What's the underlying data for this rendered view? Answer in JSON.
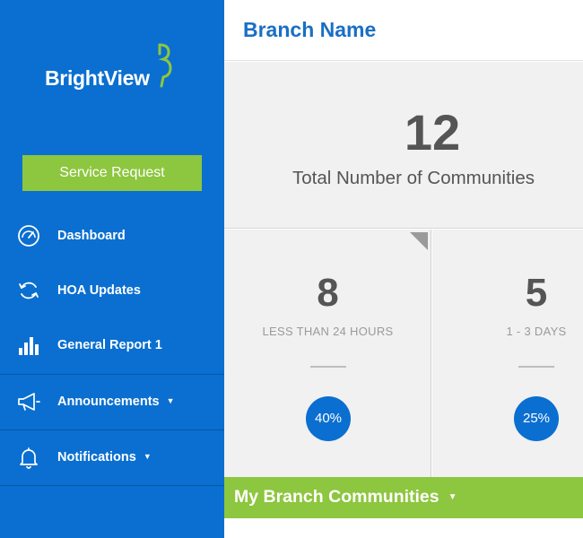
{
  "sidebar": {
    "logo_text": "BrightView",
    "service_request_label": "Service Request",
    "items": [
      {
        "label": "Dashboard",
        "icon": "speedometer-icon"
      },
      {
        "label": "HOA Updates",
        "icon": "refresh-icon"
      },
      {
        "label": "General Report 1",
        "icon": "bar-chart-icon"
      },
      {
        "label": "Announcements",
        "icon": "megaphone-icon",
        "has_dropdown": true
      },
      {
        "label": "Notifications",
        "icon": "bell-icon",
        "has_dropdown": true
      }
    ]
  },
  "header": {
    "title": "Branch Name"
  },
  "summary": {
    "total_number": "12",
    "total_label": "Total Number of Communities"
  },
  "stats": [
    {
      "number": "8",
      "label": "LESS THAN 24 HOURS",
      "percent": "40%"
    },
    {
      "number": "5",
      "label": "1 - 3 DAYS",
      "percent": "25%"
    }
  ],
  "communities": {
    "title": "My Branch Communities"
  },
  "colors": {
    "sidebar_blue": "#0a6fd0",
    "accent_green": "#8dc63f",
    "title_blue": "#1a6fc4",
    "panel_gray": "#f1f1f1",
    "text_gray": "#555555"
  }
}
